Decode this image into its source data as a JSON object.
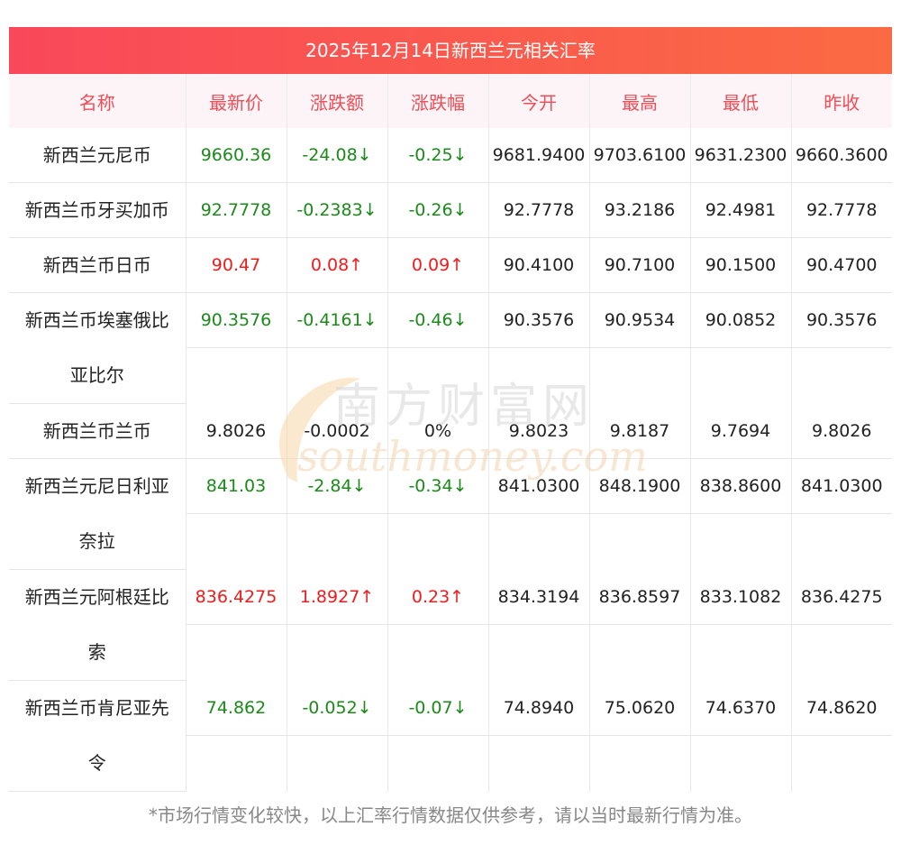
{
  "title": "2025年12月14日新西兰元相关汇率",
  "headers": [
    "名称",
    "最新价",
    "涨跌额",
    "涨跌幅",
    "今开",
    "最高",
    "最低",
    "昨收"
  ],
  "rows": [
    {
      "name": "新西兰元尼币",
      "latest": "9660.36",
      "change": "-24.08↓",
      "pct": "-0.25↓",
      "open": "9681.9400",
      "high": "9703.6100",
      "low": "9631.2300",
      "prev": "9660.3600",
      "trend": "down"
    },
    {
      "name": "新西兰币牙买加币",
      "latest": "92.7778",
      "change": "-0.2383↓",
      "pct": "-0.26↓",
      "open": "92.7778",
      "high": "93.2186",
      "low": "92.4981",
      "prev": "92.7778",
      "trend": "down"
    },
    {
      "name": "新西兰币日币",
      "latest": "90.47",
      "change": "0.08↑",
      "pct": "0.09↑",
      "open": "90.4100",
      "high": "90.7100",
      "low": "90.1500",
      "prev": "90.4700",
      "trend": "up"
    },
    {
      "name_line1": "新西兰币埃塞俄比",
      "name_line2": "亚比尔",
      "latest": "90.3576",
      "change": "-0.4161↓",
      "pct": "-0.46↓",
      "open": "90.3576",
      "high": "90.9534",
      "low": "90.0852",
      "prev": "90.3576",
      "trend": "down"
    },
    {
      "name": "新西兰币兰币",
      "latest": "9.8026",
      "change": "-0.0002",
      "pct": "0%",
      "open": "9.8023",
      "high": "9.8187",
      "low": "9.7694",
      "prev": "9.8026",
      "trend": "flat"
    },
    {
      "name_line1": "新西兰元尼日利亚",
      "name_line2": "奈拉",
      "latest": "841.03",
      "change": "-2.84↓",
      "pct": "-0.34↓",
      "open": "841.0300",
      "high": "848.1900",
      "low": "838.8600",
      "prev": "841.0300",
      "trend": "down"
    },
    {
      "name_line1": "新西兰元阿根廷比",
      "name_line2": "索",
      "latest": "836.4275",
      "change": "1.8927↑",
      "pct": "0.23↑",
      "open": "834.3194",
      "high": "836.8597",
      "low": "833.1082",
      "prev": "836.4275",
      "trend": "up"
    },
    {
      "name_line1": "新西兰币肯尼亚先",
      "name_line2": "令",
      "latest": "74.862",
      "change": "-0.052↓",
      "pct": "-0.07↓",
      "open": "74.8940",
      "high": "75.0620",
      "low": "74.6370",
      "prev": "74.8620",
      "trend": "down"
    }
  ],
  "watermark": {
    "cn": "南方财富网",
    "en": "southmoney.com"
  },
  "footer": "*市场行情变化较快，以上汇率行情数据仅供参考，请以当时最新行情为准。",
  "colors": {
    "up": "#f01b1b",
    "down": "#1b8a1b",
    "header_text": "#f04d56",
    "title_start": "#f9485a",
    "title_end": "#fb6a43"
  }
}
